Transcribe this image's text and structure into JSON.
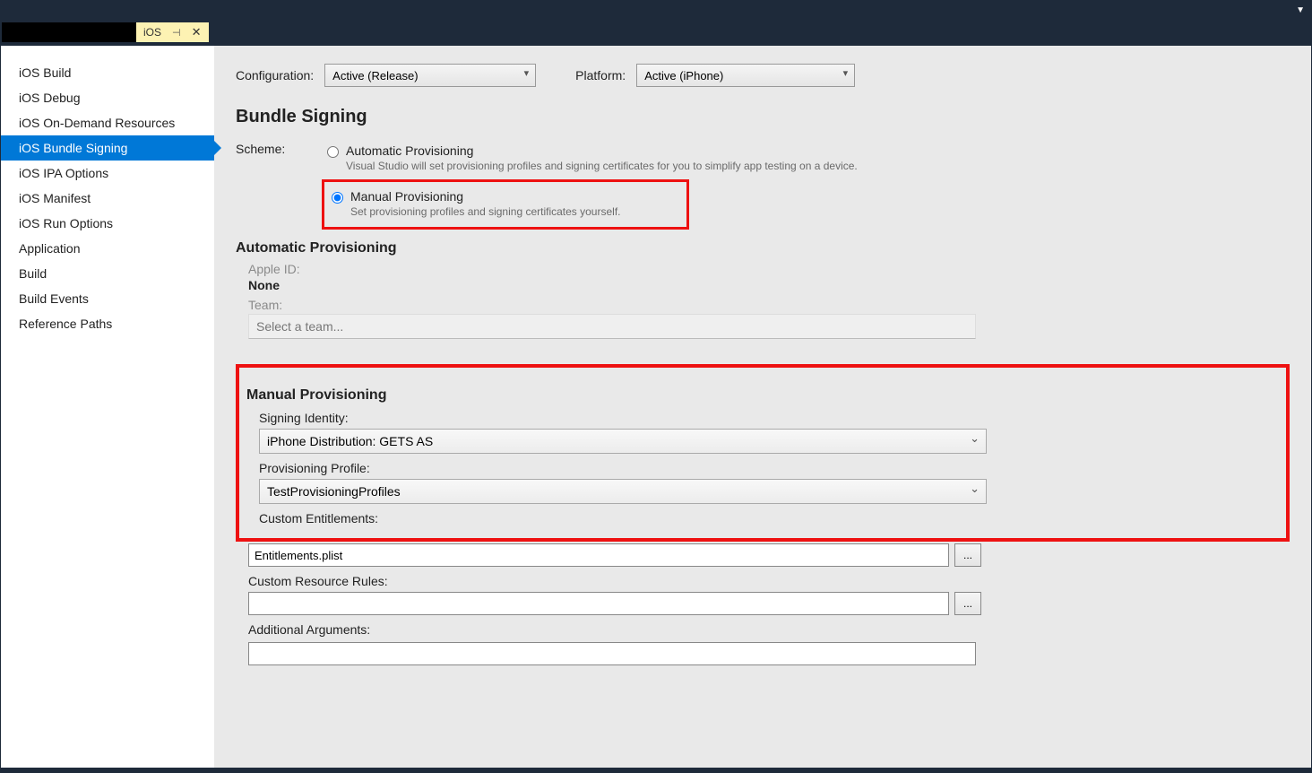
{
  "tab": {
    "label": "iOS"
  },
  "sidebar": {
    "items": [
      {
        "label": "iOS Build"
      },
      {
        "label": "iOS Debug"
      },
      {
        "label": "iOS On-Demand Resources"
      },
      {
        "label": "iOS Bundle Signing"
      },
      {
        "label": "iOS IPA Options"
      },
      {
        "label": "iOS Manifest"
      },
      {
        "label": "iOS Run Options"
      },
      {
        "label": "Application"
      },
      {
        "label": "Build"
      },
      {
        "label": "Build Events"
      },
      {
        "label": "Reference Paths"
      }
    ],
    "activeIndex": 3
  },
  "top": {
    "config_label": "Configuration:",
    "config_value": "Active (Release)",
    "platform_label": "Platform:",
    "platform_value": "Active (iPhone)"
  },
  "heading": "Bundle Signing",
  "scheme": {
    "label": "Scheme:",
    "auto_title": "Automatic Provisioning",
    "auto_desc": "Visual Studio will set provisioning profiles and signing certificates for you to simplify app testing on a device.",
    "manual_title": "Manual Provisioning",
    "manual_desc": "Set provisioning profiles and signing certificates yourself."
  },
  "auto_section": {
    "heading": "Automatic Provisioning",
    "apple_id_label": "Apple ID:",
    "apple_id_value": "None",
    "team_label": "Team:",
    "team_value": "Select a team..."
  },
  "manual_section": {
    "heading": "Manual Provisioning",
    "signing_identity_label": "Signing Identity:",
    "signing_identity_value": "iPhone Distribution: GETS AS",
    "prov_profile_label": "Provisioning Profile:",
    "prov_profile_value": "TestProvisioningProfiles",
    "custom_entitle_label": "Custom Entitlements:",
    "custom_entitle_value": "Entitlements.plist",
    "custom_resource_label": "Custom Resource Rules:",
    "custom_resource_value": "",
    "additional_args_label": "Additional Arguments:",
    "additional_args_value": "",
    "browse": "..."
  }
}
